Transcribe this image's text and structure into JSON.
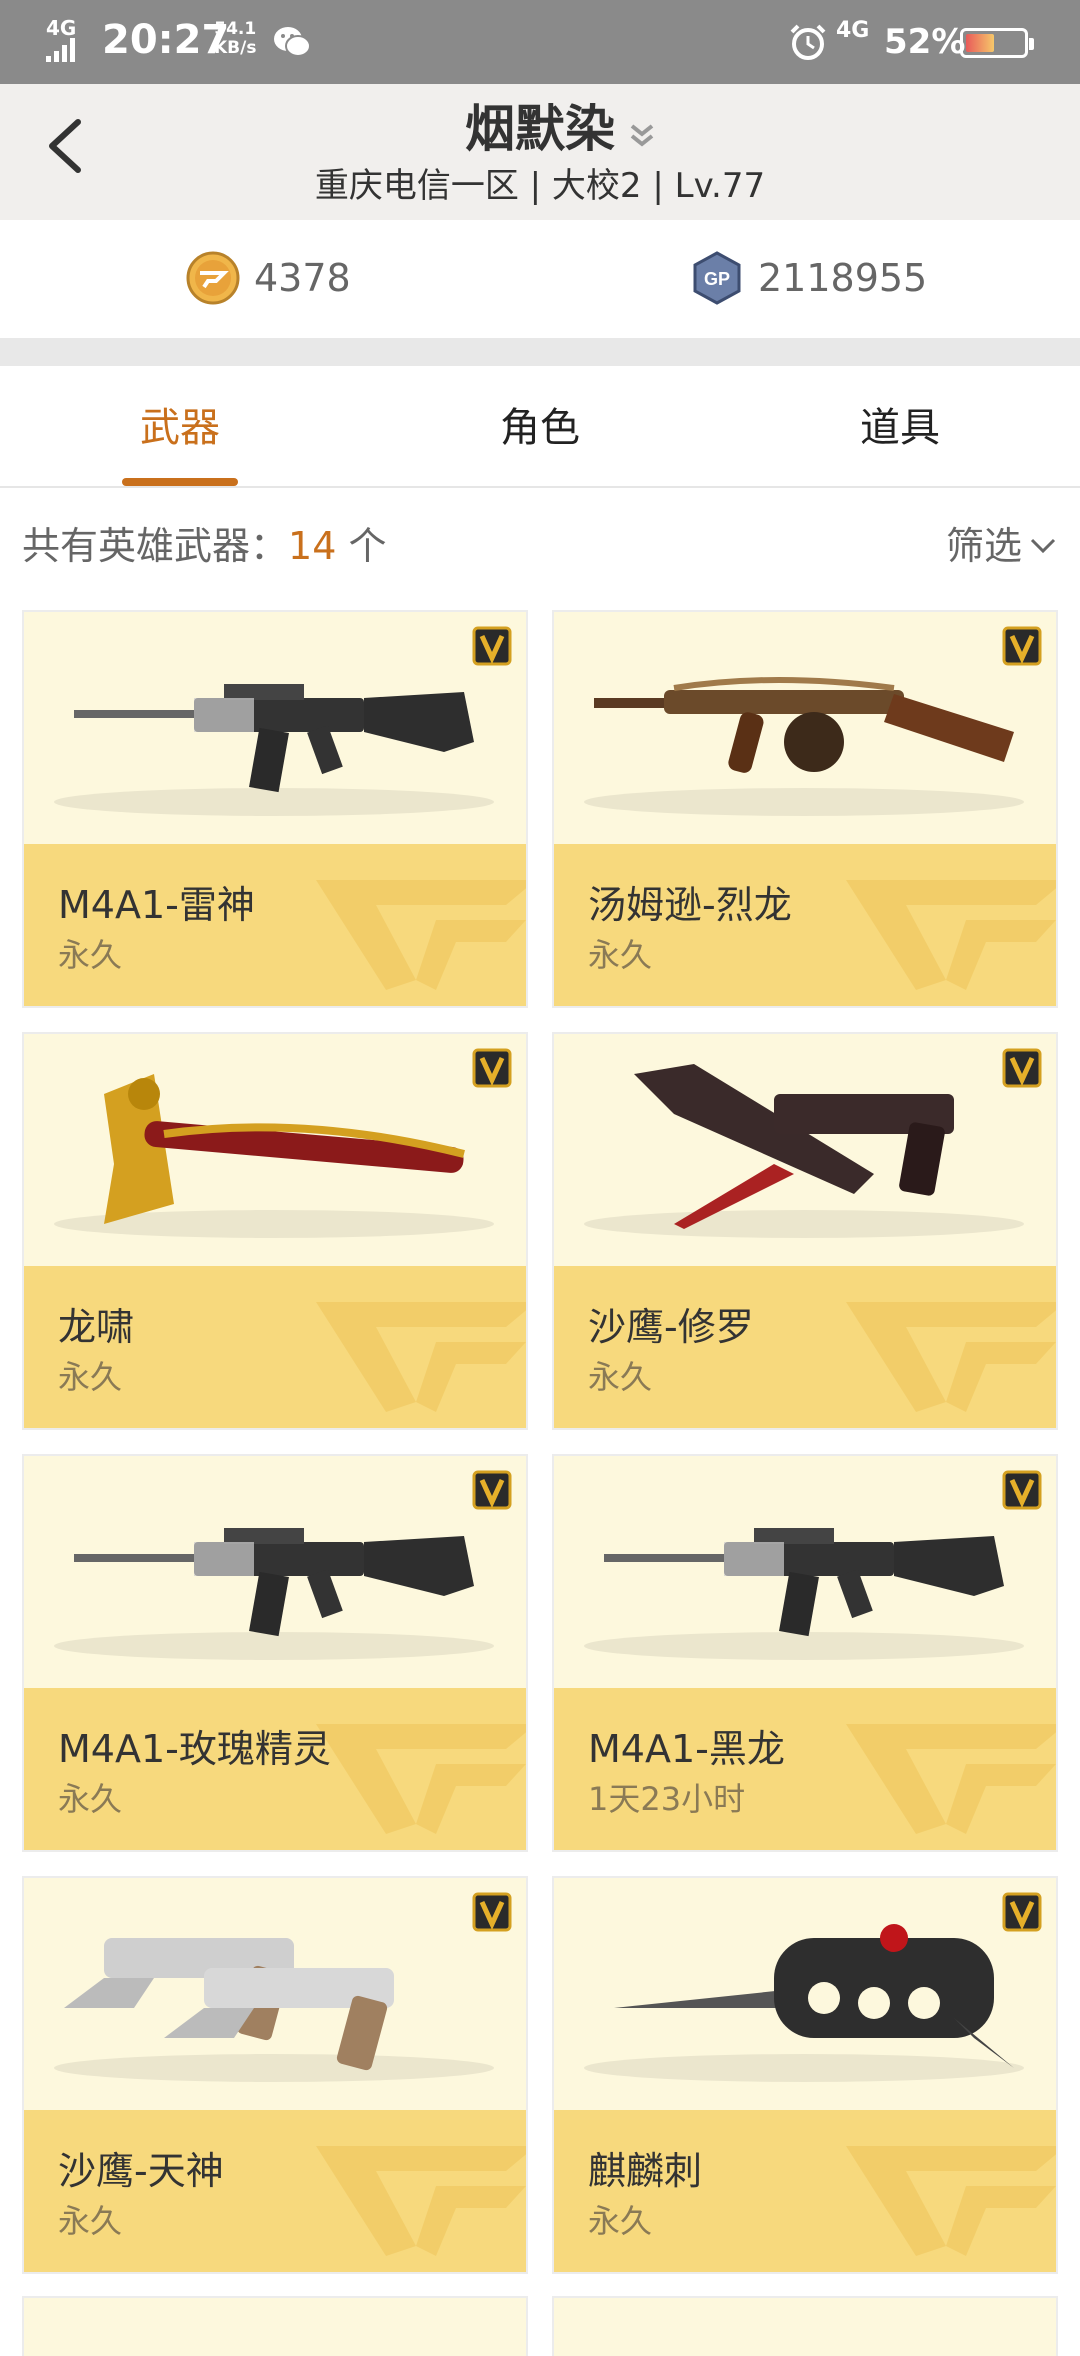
{
  "status_bar": {
    "network": "4G",
    "time": "20:27",
    "speed_value": "54.1",
    "speed_unit": "KB/s",
    "network2": "4G",
    "battery_pct": "52%"
  },
  "header": {
    "nickname": "烟默染",
    "server_info": "重庆电信一区 | 大校2 | Lv.77"
  },
  "currency": {
    "cf_points": "4378",
    "gp": "2118955"
  },
  "tabs": [
    {
      "label": "武器",
      "active": true
    },
    {
      "label": "角色",
      "active": false
    },
    {
      "label": "道具",
      "active": false
    }
  ],
  "summary": {
    "prefix": "共有英雄武器：",
    "count": "14",
    "suffix": " 个",
    "filter_label": "筛选"
  },
  "weapons": [
    {
      "name": "M4A1-雷神",
      "duration": "永久",
      "icon": "rifle-icon"
    },
    {
      "name": "汤姆逊-烈龙",
      "duration": "永久",
      "icon": "smg-icon"
    },
    {
      "name": "龙啸",
      "duration": "永久",
      "icon": "axe-icon"
    },
    {
      "name": "沙鹰-修罗",
      "duration": "永久",
      "icon": "pistol-knife-icon"
    },
    {
      "name": "M4A1-玫瑰精灵",
      "duration": "永久",
      "icon": "rifle-icon"
    },
    {
      "name": "M4A1-黑龙",
      "duration": "1天23小时",
      "icon": "rifle-icon"
    },
    {
      "name": "沙鹰-天神",
      "duration": "永久",
      "icon": "dual-pistol-icon"
    },
    {
      "name": "麒麟刺",
      "duration": "永久",
      "icon": "knuckle-knife-icon"
    }
  ],
  "colors": {
    "accent": "#c9701c",
    "card_bottom": "#f7d97d",
    "card_top": "#fdf8dd",
    "header_bg": "#f1efed"
  }
}
